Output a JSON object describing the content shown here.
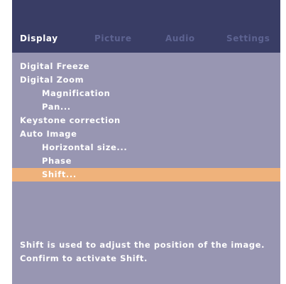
{
  "tabs": [
    {
      "label": "Display",
      "active": true
    },
    {
      "label": "Picture",
      "active": false
    },
    {
      "label": "Audio",
      "active": false
    },
    {
      "label": "Settings",
      "active": false
    }
  ],
  "menu": {
    "items": [
      {
        "label": "Digital Freeze",
        "level": 0
      },
      {
        "label": "Digital Zoom",
        "level": 0
      },
      {
        "label": "Magnification",
        "level": 1
      },
      {
        "label": "Pan...",
        "level": 1
      },
      {
        "label": "Keystone correction",
        "level": 0
      },
      {
        "label": "Auto Image",
        "level": 0
      },
      {
        "label": "Horizontal size...",
        "level": 1
      },
      {
        "label": "Phase",
        "level": 1
      },
      {
        "label": "Shift...",
        "level": 1,
        "selected": true
      }
    ]
  },
  "help": {
    "line1": "Shift is used to adjust the position of the image.",
    "line2": "Confirm to activate Shift."
  },
  "colors": {
    "header_bg": "#393d65",
    "panel_bg": "#9896b2",
    "selection": "#efb27b",
    "inactive_tab": "#5d6391",
    "text": "#ffffff"
  }
}
